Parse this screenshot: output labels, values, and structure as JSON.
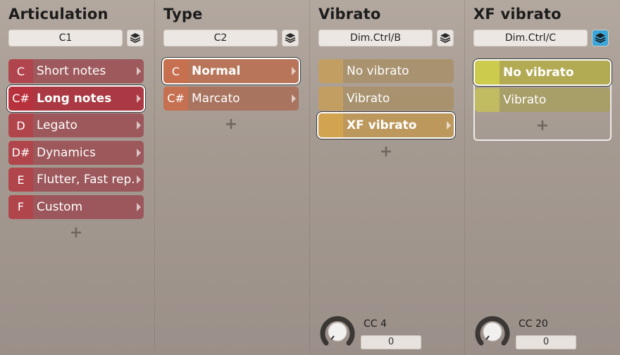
{
  "columns": [
    {
      "title": "Articulation",
      "selector": "C1",
      "layers_active": false,
      "items": [
        {
          "note": "C",
          "label": "Short notes",
          "selected": false
        },
        {
          "note": "C#",
          "label": "Long notes",
          "selected": true
        },
        {
          "note": "D",
          "label": "Legato",
          "selected": false
        },
        {
          "note": "D#",
          "label": "Dynamics",
          "selected": false
        },
        {
          "note": "E",
          "label": "Flutter, Fast rep.",
          "selected": false
        },
        {
          "note": "F",
          "label": "Custom",
          "selected": false
        }
      ],
      "add_label": "+"
    },
    {
      "title": "Type",
      "selector": "C2",
      "layers_active": false,
      "items": [
        {
          "note": "C",
          "label": "Normal",
          "selected": true
        },
        {
          "note": "C#",
          "label": "Marcato",
          "selected": false
        }
      ],
      "add_label": "+"
    },
    {
      "title": "Vibrato",
      "selector": "Dim.Ctrl/B",
      "layers_active": false,
      "items": [
        {
          "note": "",
          "label": "No vibrato",
          "selected": false
        },
        {
          "note": "",
          "label": "Vibrato",
          "selected": false
        },
        {
          "note": "",
          "label": "XF vibrato",
          "selected": true
        }
      ],
      "add_label": "+",
      "cc": {
        "label": "CC 4",
        "value": "0"
      }
    },
    {
      "title": "XF vibrato",
      "selector": "Dim.Ctrl/C",
      "layers_active": true,
      "items": [
        {
          "note": "",
          "label": "No vibrato",
          "selected": true
        },
        {
          "note": "",
          "label": "Vibrato",
          "selected": false
        }
      ],
      "add_label": "+",
      "cc": {
        "label": "CC 20",
        "value": "0"
      }
    }
  ],
  "colors": {
    "accent_active_layer": "#3aa6d9",
    "articulation": "#b8323e",
    "type": "#c67050",
    "vibrato": "#d2a450",
    "xf_vibrato": "#cccb4e"
  },
  "icons": {
    "layer_button": "layers-icon",
    "row_arrow": "chevron-right-icon",
    "knob": "knob-icon"
  }
}
